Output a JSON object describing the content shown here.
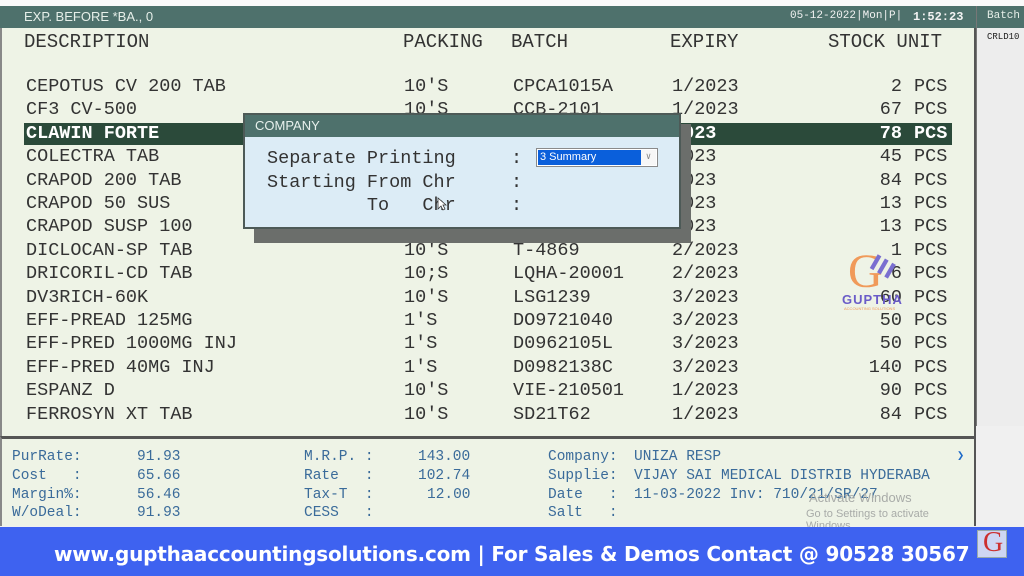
{
  "titlebar": {
    "title": "EXP. BEFORE *BA.,  0",
    "datetime": "05-12-2022|Mon|P|",
    "clock": "1:52:23"
  },
  "side_panel": {
    "header": "Batch",
    "value": "CRLD10"
  },
  "columns": {
    "description": "DESCRIPTION",
    "packing": "PACKING",
    "batch": "BATCH",
    "expiry": "EXPIRY",
    "stock_unit": "STOCK UNIT"
  },
  "rows": [
    {
      "description": "CEPOTUS CV 200 TAB",
      "packing": "10'S",
      "batch": "CPCA1015A",
      "expiry": "1/2023",
      "stock": "2",
      "unit": "PCS"
    },
    {
      "description": "CF3 CV-500",
      "packing": "10'S",
      "batch": "CCB-2101",
      "expiry": "1/2023",
      "stock": "67",
      "unit": "PCS"
    },
    {
      "description": "CLAWIN FORTE",
      "packing": "",
      "batch": "",
      "expiry": "2023",
      "stock": "78",
      "unit": "PCS",
      "selected": true
    },
    {
      "description": "COLECTRA TAB",
      "packing": "",
      "batch": "",
      "expiry": "2023",
      "stock": "45",
      "unit": "PCS"
    },
    {
      "description": "CRAPOD 200 TAB",
      "packing": "",
      "batch": "",
      "expiry": "2023",
      "stock": "84",
      "unit": "PCS"
    },
    {
      "description": "CRAPOD 50 SUS",
      "packing": "",
      "batch": "",
      "expiry": "2023",
      "stock": "13",
      "unit": "PCS"
    },
    {
      "description": "CRAPOD SUSP 100",
      "packing": "",
      "batch": "",
      "expiry": "2023",
      "stock": "13",
      "unit": "PCS"
    },
    {
      "description": "DICLOCAN-SP TAB",
      "packing": "10'S",
      "batch": "T-4869",
      "expiry": "2/2023",
      "stock": "1",
      "unit": "PCS"
    },
    {
      "description": "DRICORIL-CD TAB",
      "packing": "10;S",
      "batch": "LQHA-20001",
      "expiry": "2/2023",
      "stock": "6",
      "unit": "PCS"
    },
    {
      "description": "DV3RICH-60K",
      "packing": "10'S",
      "batch": "LSG1239",
      "expiry": "3/2023",
      "stock": "60",
      "unit": "PCS"
    },
    {
      "description": "EFF-PREAD 125MG",
      "packing": "1'S",
      "batch": "DO9721040",
      "expiry": "3/2023",
      "stock": "50",
      "unit": "PCS"
    },
    {
      "description": "EFF-PRED 1000MG INJ",
      "packing": "1'S",
      "batch": "D0962105L",
      "expiry": "3/2023",
      "stock": "50",
      "unit": "PCS"
    },
    {
      "description": "EFF-PRED 40MG INJ",
      "packing": "1'S",
      "batch": "D0982138C",
      "expiry": "3/2023",
      "stock": "140",
      "unit": "PCS"
    },
    {
      "description": "ESPANZ D",
      "packing": "10'S",
      "batch": "VIE-210501",
      "expiry": "1/2023",
      "stock": "90",
      "unit": "PCS"
    },
    {
      "description": "FERROSYN XT TAB",
      "packing": "10'S",
      "batch": "SD21T62",
      "expiry": "1/2023",
      "stock": "84",
      "unit": "PCS"
    }
  ],
  "details": {
    "purrate_label": "PurRate:",
    "purrate": "91.93",
    "cost_label": "Cost   :",
    "cost": "65.66",
    "margin_label": "Margin%:",
    "margin": "56.46",
    "wodeal_label": "W/oDeal:",
    "wodeal": "91.93",
    "mrp_label": "M.R.P. :",
    "mrp": "143.00",
    "rate_label": "Rate   :",
    "rate": "102.74",
    "taxt_label": "Tax-T  :",
    "taxt": "12.00",
    "cess_label": "CESS   :",
    "cess": "",
    "company_label": "Company:",
    "company": "UNIZA RESP",
    "supplier_label": "Supplie:",
    "supplier": "VIJAY SAI MEDICAL DISTRIB HYDERABA",
    "date_label": "Date   :",
    "date": "11-03-2022 Inv: 710/21/SR/27",
    "salt_label": "Salt   :",
    "salt": ""
  },
  "activation_notice": {
    "title": "Activate Windows",
    "subtitle": "Go to Settings to activate Windows."
  },
  "dialog": {
    "title": "COMPANY",
    "line1": "Separate Printing",
    "line2": "Starting From Chr",
    "line3": "         To   Chr",
    "colon": ":",
    "separate_printing_value": "3 Summary",
    "dropdown_arrow": "∨"
  },
  "watermark": {
    "letter": "G",
    "name": "GUPTHA",
    "sub": "ACCOUNTING SOLUTIONS"
  },
  "banner": {
    "text": "www.gupthaaccountingsolutions.com | For Sales & Demos Contact @ 90528 30567",
    "logo_letter": "G"
  }
}
